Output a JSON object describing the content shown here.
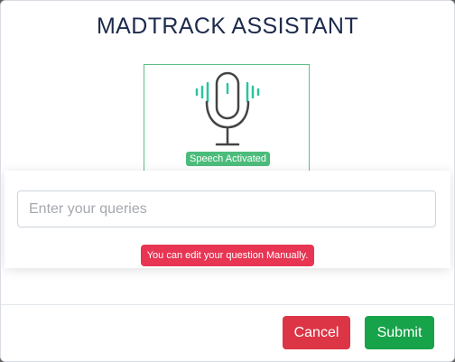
{
  "dialog": {
    "title": "MADTRACK ASSISTANT"
  },
  "mic": {
    "icon": "microphone-icon",
    "status_badge": "Speech Activated",
    "accent_color": "#2cc4a0"
  },
  "query": {
    "placeholder": "Enter your queries",
    "value": "",
    "hint": "You can edit your question Manually."
  },
  "footer": {
    "cancel_label": "Cancel",
    "submit_label": "Submit"
  },
  "colors": {
    "title": "#1d2a4d",
    "speech_badge": "#4cbc7c",
    "hint_badge": "#e73553",
    "cancel": "#dc3545",
    "submit": "#17a34a"
  }
}
